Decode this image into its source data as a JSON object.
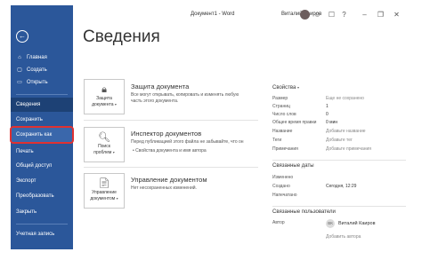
{
  "window": {
    "title": "Документ1 - Word",
    "user": "Виталий Каиров",
    "icons": [
      "emoji-icon",
      "feedback-icon",
      "help-icon",
      "minimize-icon",
      "restore-icon",
      "close-icon"
    ]
  },
  "sidebar": {
    "items": [
      {
        "label": "Главная",
        "icon": "home-icon",
        "glyph": "⌂"
      },
      {
        "label": "Создать",
        "icon": "new-doc-icon",
        "glyph": "▢"
      },
      {
        "label": "Открыть",
        "icon": "folder-icon",
        "glyph": "▭"
      },
      {
        "label": "Сведения"
      },
      {
        "label": "Сохранить"
      },
      {
        "label": "Сохранить как"
      },
      {
        "label": "Печать"
      },
      {
        "label": "Общий доступ"
      },
      {
        "label": "Экспорт"
      },
      {
        "label": "Преобразовать"
      },
      {
        "label": "Закрыть"
      },
      {
        "label": "Учетная запись"
      }
    ],
    "back_glyph": "←",
    "accent_color": "#2b579a",
    "highlight_color": "#e03131"
  },
  "main": {
    "title": "Сведения",
    "sections": [
      {
        "button_line1": "Защита",
        "button_line2": "документа",
        "icon": "lock-icon",
        "title": "Защита документа",
        "description": "Все могут открывать, копировать и изменять любую часть этого документа."
      },
      {
        "button_line1": "Поиск",
        "button_line2": "проблем",
        "icon": "inspect-icon",
        "title": "Инспектор документов",
        "description": "Перед публикацией этого файла не забывайте, что он",
        "bullet": "Свойства документа и имя автора"
      },
      {
        "button_line1": "Управление",
        "button_line2": "документом",
        "icon": "manage-doc-icon",
        "title": "Управление документом",
        "description": "Нет несохраненных изменений."
      }
    ]
  },
  "properties": {
    "header": "Свойства",
    "rows": [
      {
        "label": "Размер",
        "value": "Еще не сохранено"
      },
      {
        "label": "Страниц",
        "value": "1"
      },
      {
        "label": "Число слов",
        "value": "0"
      },
      {
        "label": "Общее время правки",
        "value": "0 мин"
      },
      {
        "label": "Название",
        "value": "Добавьте название"
      },
      {
        "label": "Теги",
        "value": "Добавьте тег"
      },
      {
        "label": "Примечания",
        "value": "Добавьте примечания"
      }
    ],
    "dates_header": "Связанные даты",
    "dates": [
      {
        "label": "Изменено",
        "value": ""
      },
      {
        "label": "Создано",
        "value": "Сегодня, 12:29"
      },
      {
        "label": "Напечатано",
        "value": ""
      }
    ],
    "people_header": "Связанные пользователи",
    "people": {
      "author_label": "Автор",
      "avatar_initials": "ВК",
      "author_name": "Виталий Каиров",
      "add_author": "Добавить автора"
    }
  }
}
